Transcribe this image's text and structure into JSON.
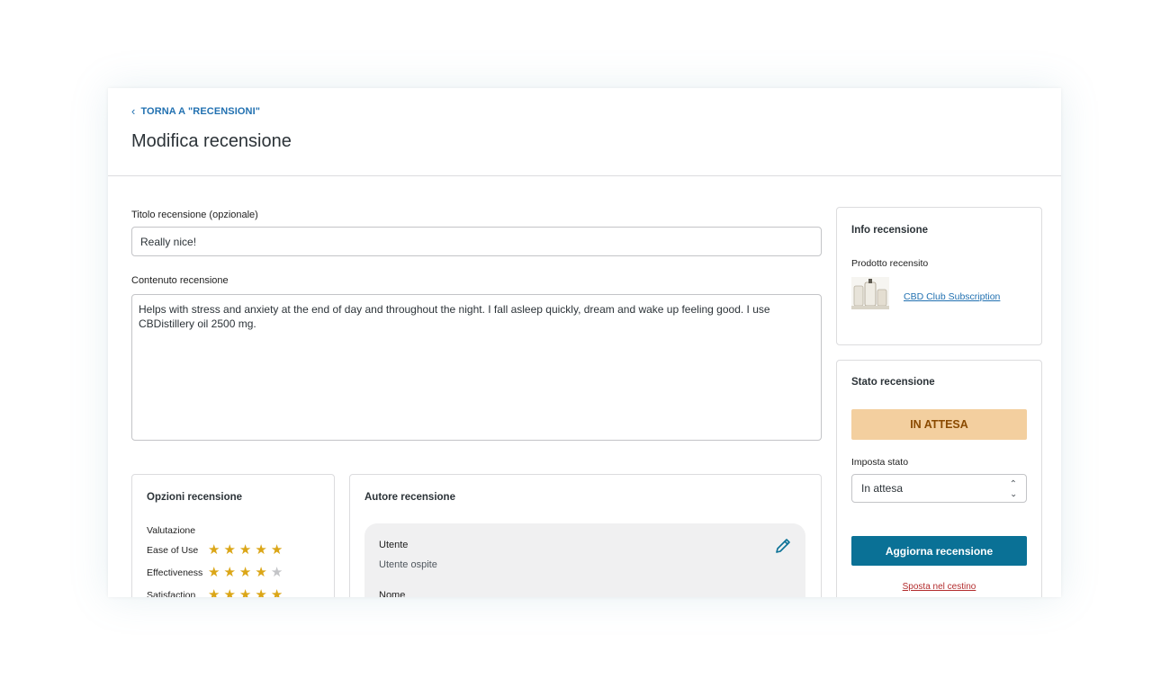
{
  "header": {
    "back_label": "TORNA A \"RECENSIONI\"",
    "page_title": "Modifica recensione"
  },
  "form": {
    "title_label": "Titolo recensione (opzionale)",
    "title_value": "Really nice!",
    "content_label": "Contenuto recensione",
    "content_value": "Helps with stress and anxiety at the end of day and throughout the night. I fall asleep quickly, dream and wake up feeling good. I use CBDistillery oil 2500 mg."
  },
  "options": {
    "title": "Opzioni recensione",
    "rating_label": "Valutazione",
    "ratings": [
      {
        "label": "Ease of Use",
        "stars": 5
      },
      {
        "label": "Effectiveness",
        "stars": 4
      },
      {
        "label": "Satisfaction",
        "stars": 5
      }
    ]
  },
  "author": {
    "title": "Autore recensione",
    "user_label": "Utente",
    "user_value": "Utente ospite",
    "name_label": "Nome",
    "edit_icon": "pencil-icon"
  },
  "info": {
    "title": "Info recensione",
    "product_label": "Prodotto recensito",
    "product_name": "CBD Club Subscription"
  },
  "status": {
    "title": "Stato recensione",
    "badge": "IN ATTESA",
    "badge_color": "#f3cf9f",
    "set_label": "Imposta stato",
    "selected": "In attesa",
    "update_button": "Aggiorna recensione",
    "trash_link": "Sposta nel cestino",
    "primary_color": "#0a7196"
  }
}
